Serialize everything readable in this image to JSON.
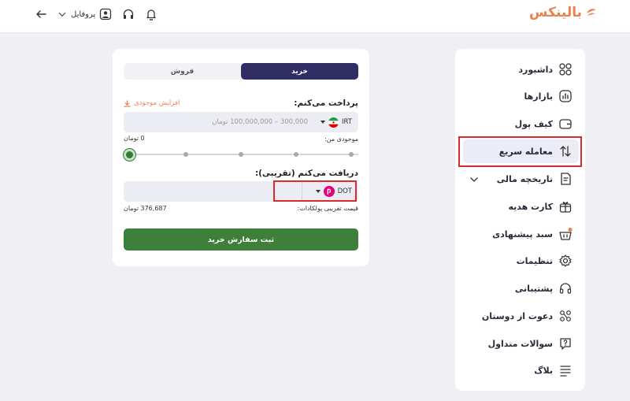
{
  "header": {
    "logo_text": "بالینکس",
    "profile_label": "پروفایل"
  },
  "sidebar": {
    "items": [
      {
        "label": "داشبورد",
        "icon": "grid-icon"
      },
      {
        "label": "بازارها",
        "icon": "chart-icon"
      },
      {
        "label": "کیف پول",
        "icon": "wallet-icon"
      },
      {
        "label": "معامله سریع",
        "icon": "swap-arrows-icon",
        "active": true
      },
      {
        "label": "تاریخچه مالی",
        "icon": "history-icon"
      },
      {
        "label": "کارت هدیه",
        "icon": "gift-icon"
      },
      {
        "label": "سبد پیشنهادی",
        "icon": "basket-icon"
      },
      {
        "label": "تنظیمات",
        "icon": "gear-icon"
      },
      {
        "label": "پشتیبانی",
        "icon": "headset-icon"
      },
      {
        "label": "دعوت از دوستان",
        "icon": "people-icon"
      },
      {
        "label": "سوالات متداول",
        "icon": "question-icon"
      },
      {
        "label": "بلاگ",
        "icon": "blog-icon"
      }
    ]
  },
  "trade": {
    "tab_buy": "خرید",
    "tab_sell": "فروش",
    "pay_label": "پرداخت می‌کنم:",
    "increase_balance": "افزایش موجودی",
    "pay_currency": "IRT",
    "pay_placeholder": "300,000 – 100,000,000 تومان",
    "balance_label": "موجودی من:",
    "balance_value": "0 تومان",
    "receive_label": "دریافت می‌کنم (تقریبی):",
    "receive_currency": "DOT",
    "price_label": "قیمت تقریبی پولکادات:",
    "price_value": "376,687 تومان",
    "submit_label": "ثبت سفارش خرید"
  },
  "colors": {
    "accent": "#2f2d63",
    "brand": "#e8834f",
    "submit": "#3e7f3a",
    "highlight": "#d92b2b",
    "polkadot": "#e6007a"
  }
}
